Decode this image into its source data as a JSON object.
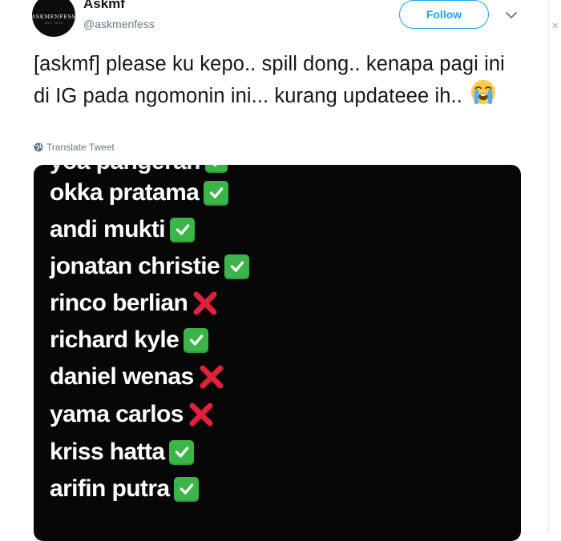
{
  "tweet": {
    "display_name": "Askmf",
    "handle": "@askmenfess",
    "avatar_logo": "ASKMENFESS",
    "avatar_sub": "EST. 2019",
    "follow_label": "Follow",
    "text": "[askmf] please ku kepo.. spill dong.. kenapa pagi ini di IG pada ngomonin ini... kurang updateee ih..",
    "emoji": "loudly-crying-face",
    "translate_label": "Translate Tweet"
  },
  "media": {
    "items": [
      {
        "name": "okka pratama",
        "mark": "check"
      },
      {
        "name": "andi mukti",
        "mark": "check"
      },
      {
        "name": "jonatan christie",
        "mark": "check"
      },
      {
        "name": "rinco berlian",
        "mark": "cross"
      },
      {
        "name": "richard kyle",
        "mark": "check"
      },
      {
        "name": "daniel wenas",
        "mark": "cross"
      },
      {
        "name": "yama carlos",
        "mark": "cross"
      },
      {
        "name": "kriss hatta",
        "mark": "check"
      },
      {
        "name": "arifin putra",
        "mark": "check"
      }
    ]
  },
  "colors": {
    "accent": "#1da1f2",
    "check": "#3bb54a",
    "cross": "#e0203c",
    "media_bg": "#070707"
  }
}
